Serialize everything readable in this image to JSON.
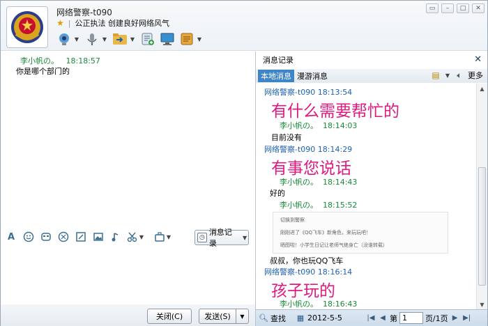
{
  "window": {
    "title": "网络警察-t090",
    "signature": "公正执法 创建良好网络风气",
    "controls": [
      "skin-icon",
      "minimize-icon",
      "maximize-icon",
      "close-icon"
    ]
  },
  "toolbar": {
    "items": [
      {
        "name": "video-call",
        "icon": "webcam-icon"
      },
      {
        "name": "voice-call",
        "icon": "microphone-icon"
      },
      {
        "name": "send-file",
        "icon": "folder-arrow-icon"
      },
      {
        "name": "create-group",
        "icon": "list-add-icon"
      },
      {
        "name": "remote-assist",
        "icon": "monitor-icon"
      },
      {
        "name": "app",
        "icon": "app-box-icon"
      }
    ]
  },
  "chat": {
    "messages": [
      {
        "sender": "李小帆の。",
        "time": "18:18:57",
        "text": "你是哪个部门的"
      }
    ]
  },
  "format_bar": {
    "history_label": "消息记录"
  },
  "buttons": {
    "close": "关闭(C)",
    "send": "发送(S)"
  },
  "history": {
    "title": "消息记录",
    "tabs": [
      "本地消息",
      "漫游消息"
    ],
    "more_label": "更多",
    "entries": [
      {
        "sender": "网络警察-t090",
        "time": "18:13:54",
        "text": "有什么需要帮忙的",
        "style": "big"
      },
      {
        "sender": "李小帆の。",
        "time": "18:14:03",
        "text": "目前没有",
        "style": "plain"
      },
      {
        "sender": "网络警察-t090",
        "time": "18:14:29",
        "text": "有事您说话",
        "style": "big"
      },
      {
        "sender": "李小帆の。",
        "time": "18:14:43",
        "text": "好的",
        "style": "plain"
      },
      {
        "sender": "李小帆の。",
        "time": "18:15:52",
        "text": "",
        "style": "plain"
      },
      {
        "sender": "",
        "time": "",
        "text": "叔叔，你也玩QQ飞车",
        "style": "plain"
      },
      {
        "sender": "网络警察-t090",
        "time": "18:16:14",
        "text": "孩子玩的",
        "style": "big"
      },
      {
        "sender": "李小帆の。",
        "time": "18:16:43",
        "text": "",
        "style": "plain"
      }
    ],
    "embedded": {
      "line1": "切换到警察",
      "line2": "刚刚进了《QQ飞车》新角色，来玩玩吧！",
      "line3": "晒图啦！小学生日记让老师气绝身亡（没谁转载）"
    },
    "footer": {
      "search_label": "查找",
      "date": "2012-5-5",
      "page_prefix": "第",
      "page_value": "1",
      "page_suffix": "页/1页"
    }
  }
}
